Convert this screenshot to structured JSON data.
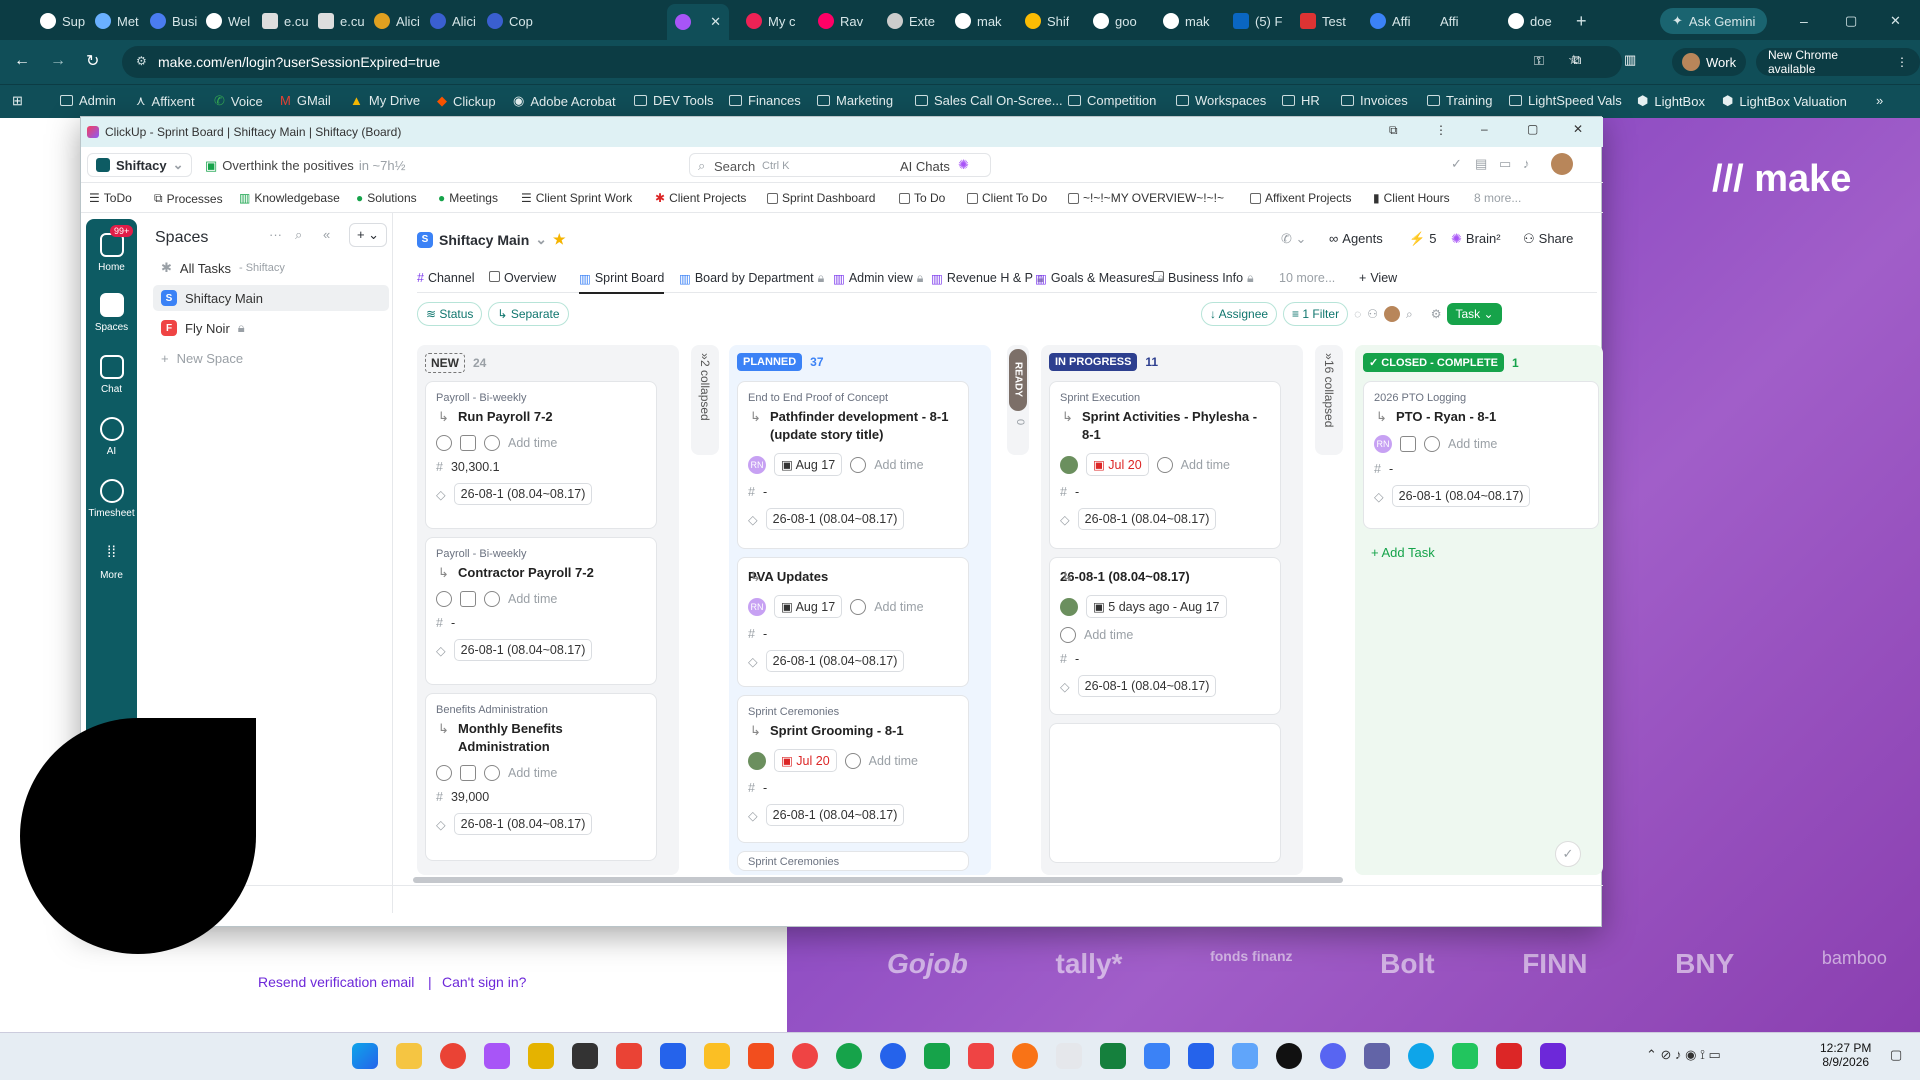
{
  "browser": {
    "tabs": [
      "Sup",
      "Met",
      "Busi",
      "Wel",
      "e.cu",
      "e.cu",
      "Alici",
      "Alici",
      "Cop",
      "",
      "My c",
      "Rav",
      "Exte",
      "mak",
      "Shif",
      "goo",
      "mak",
      "(5) F",
      "Test",
      "Affi",
      "Affi",
      "doe"
    ],
    "active_tab_index": 9,
    "ask_gemini": "Ask Gemini",
    "url": "make.com/en/login?userSessionExpired=true",
    "profile": "Work",
    "new_chrome": "New Chrome available",
    "bookmarks": [
      "Admin",
      "Affixent",
      "Voice",
      "GMail",
      "My Drive",
      "Clickup",
      "Adobe Acrobat",
      "DEV Tools",
      "Finances",
      "Marketing",
      "Sales Call On-Scree...",
      "Competition",
      "Workspaces",
      "HR",
      "Invoices",
      "Training",
      "LightSpeed Vals",
      "LightBox",
      "LightBox Valuation"
    ]
  },
  "make_page": {
    "logo": "make",
    "resend": "Resend verification email",
    "cant_sign": "Can't sign in?",
    "brands": [
      "Gojob",
      "tally*",
      "fonds finanz",
      "Bolt",
      "FINN",
      "BNY",
      "bamboo"
    ]
  },
  "clickup": {
    "window_title": "ClickUp - Sprint Board | Shiftacy Main | Shiftacy (Board)",
    "workspace": "Shiftacy",
    "status_msg": "Overthink the positives",
    "status_time": "in ~7h½",
    "search": "Search",
    "search_shortcut": "Ctrl K",
    "ai_chats": "AI Chats",
    "favorites": [
      "ToDo",
      "Processes",
      "Knowledgebase",
      "Solutions",
      "Meetings",
      "Client Sprint Work",
      "Client Projects",
      "Sprint Dashboard",
      "To Do",
      "Client To Do",
      "~!~!~MY OVERVIEW~!~!~",
      "Affixent Projects",
      "Client Hours",
      "8 more..."
    ],
    "rail": [
      {
        "label": "Home",
        "badge": "99+"
      },
      {
        "label": "Spaces"
      },
      {
        "label": "Chat"
      },
      {
        "label": "AI"
      },
      {
        "label": "Timesheet"
      },
      {
        "label": "More"
      }
    ],
    "sidebar": {
      "title": "Spaces",
      "all_tasks": "All Tasks",
      "all_tasks_sub": "- Shiftacy",
      "spaces": [
        {
          "initial": "S",
          "name": "Shiftacy Main",
          "color": "#3b82f6"
        },
        {
          "initial": "F",
          "name": "Fly Noir",
          "color": "#ef4444"
        }
      ],
      "new_space": "New Space"
    },
    "space_title": "Shiftacy Main",
    "header_actions": {
      "agents": "Agents",
      "count": "5",
      "brain": "Brain²",
      "share": "Share"
    },
    "views": [
      "Channel",
      "Overview",
      "Sprint Board",
      "Board by Department",
      "Admin view",
      "Revenue H & P",
      "Goals & Measures",
      "Business Info",
      "10 more...",
      "View"
    ],
    "filters": {
      "status": "Status",
      "separate": "Separate",
      "assignee": "Assignee",
      "filter": "1 Filter",
      "task": "Task"
    },
    "columns": [
      {
        "name": "NEW",
        "count": "24",
        "color": "#ffffff",
        "cards": [
          {
            "ctx": "Payroll - Bi-weekly",
            "title": "Run Payroll 7-2",
            "add_time": "Add time",
            "number": "30,300.1",
            "sprint": "26-08-1 (08.04~08.17)"
          },
          {
            "ctx": "Payroll - Bi-weekly",
            "title": "Contractor Payroll 7-2",
            "add_time": "Add time",
            "number": "-",
            "sprint": "26-08-1 (08.04~08.17)"
          },
          {
            "ctx": "Benefits Administration",
            "title": "Monthly Benefits Administration",
            "add_time": "Add time",
            "number": "39,000",
            "sprint": "26-08-1 (08.04~08.17)"
          }
        ]
      },
      {
        "name": "PLANNED",
        "count": "37",
        "color": "#3b82f6",
        "cards": [
          {
            "ctx": "End to End Proof of Concept",
            "title": "Pathfinder development - 8-1 (update story title)",
            "assignee": "RN",
            "date": "Aug 17",
            "add_time": "Add time",
            "number": "-",
            "sprint": "26-08-1 (08.04~08.17)"
          },
          {
            "ctx": "",
            "title": "PVA Updates",
            "assignee": "RN",
            "date": "Aug 17",
            "add_time": "Add time",
            "number": "-",
            "sprint": "26-08-1 (08.04~08.17)"
          },
          {
            "ctx": "Sprint Ceremonies",
            "title": "Sprint Grooming - 8-1",
            "date": "Jul 20",
            "add_time": "Add time",
            "number": "-",
            "sprint": "26-08-1 (08.04~08.17)"
          }
        ]
      },
      {
        "name": "IN PROGRESS",
        "count": "11",
        "color": "#2d3f8f",
        "cards": [
          {
            "ctx": "Sprint Execution",
            "title": "Sprint Activities - Phylesha - 8-1",
            "date": "Jul 20",
            "add_time": "Add time",
            "number": "-",
            "sprint": "26-08-1 (08.04~08.17)"
          },
          {
            "ctx": "",
            "title": "26-08-1 (08.04~08.17)",
            "date": "5 days ago - Aug 17",
            "add_time": "Add time",
            "number": "-",
            "sprint": "26-08-1 (08.04~08.17)"
          }
        ]
      },
      {
        "name": "CLOSED - COMPLETE",
        "count": "1",
        "color": "#15a34a",
        "cards": [
          {
            "ctx": "2026 PTO Logging",
            "title": "PTO - Ryan - 8-1",
            "assignee": "RN",
            "add_time": "Add time",
            "number": "-",
            "sprint": "26-08-1 (08.04~08.17)"
          }
        ]
      }
    ],
    "collapsed": [
      "2 collapsed",
      "16 collapsed"
    ],
    "ready": {
      "name": "READY",
      "count": "0"
    },
    "add_task": "Add Task",
    "next_ctx_partial": "Sprint Ceremonies"
  },
  "taskbar": {
    "time": "12:27 PM",
    "date": "8/9/2026"
  }
}
